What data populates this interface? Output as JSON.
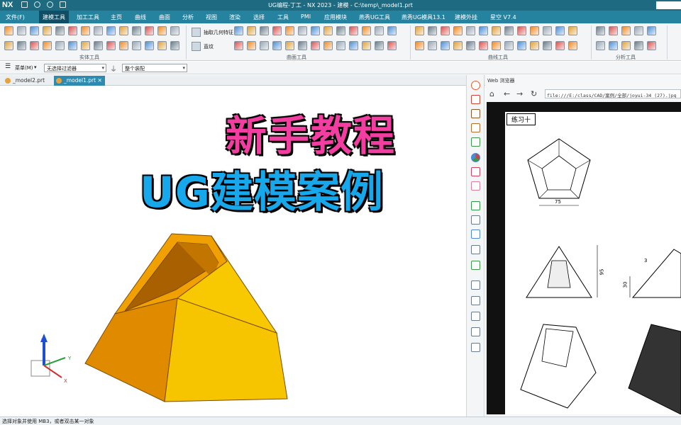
{
  "titlebar": {
    "logo": "NX",
    "title": "UG编程-丁工 - NX 2023 - 建模 - C:\\temp\\_model1.prt"
  },
  "menu": {
    "items": [
      "文件(F)",
      "建模工具",
      "加工工具",
      "主页",
      "曲线",
      "曲面",
      "分析",
      "视图",
      "渲染",
      "选择",
      "工具",
      "PMI",
      "应用模块",
      "燕秀UG工具",
      "燕秀UG模具13.1",
      "建模外挂",
      "星空 V7.4"
    ],
    "active": "建模工具"
  },
  "ribbon": {
    "groups": [
      "实体工具",
      "曲面工具",
      "曲线工具",
      "分析工具"
    ],
    "extract_label": "抽取几何特征",
    "wrinkle_label": "直纹"
  },
  "filterbar": {
    "menu_label": "菜单(M)",
    "filter": "无选择过滤器",
    "scope": "整个装配"
  },
  "tabs": [
    "_model2.prt",
    "_model1.prt"
  ],
  "active_tab": "_model1.prt",
  "viewport": {
    "headline1": "新手教程",
    "headline2": "UG建模案例",
    "axes": {
      "z": "Z",
      "y": "Y",
      "x": "X"
    }
  },
  "browser": {
    "title": "Web 浏览器",
    "url": "file:///E:/class/CAD/案例/全部/joyui-34 (27).jpg",
    "exercise_label": "练习十",
    "dims": {
      "width": "75",
      "height": "95",
      "offset": "30",
      "small": "3"
    }
  },
  "status": {
    "text": "选择对象并使用 MB3，或者双击某一对象"
  },
  "colors": {
    "menubar": "#2683a0",
    "titlebar": "#1e6a80",
    "model_main": "#f7b500",
    "model_dark": "#e08a00",
    "headline1": "#f13ea0",
    "headline2": "#17a8ec"
  }
}
